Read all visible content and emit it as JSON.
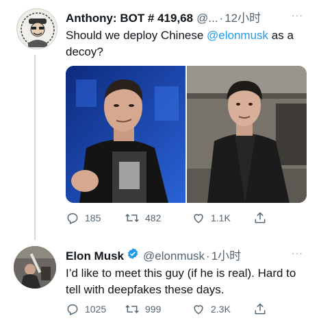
{
  "tweet1": {
    "display_name": "Anthony: BOT # 419,68",
    "handle": "@...",
    "time": "12小时",
    "more_label": "···",
    "text_before": "Should we deploy Chinese ",
    "mention": "@elonmusk",
    "text_after": " as a decoy?",
    "actions": {
      "replies": "185",
      "retweets": "482",
      "likes": "1.1K"
    }
  },
  "tweet2": {
    "display_name": "Elon Musk",
    "handle": "@elonmusk",
    "time": "1小时",
    "more_label": "···",
    "text": "I’d like to meet this guy (if he is real). Hard to tell with deepfakes these days.",
    "actions": {
      "replies": "1025",
      "retweets": "999",
      "likes": "2.3K"
    }
  },
  "colors": {
    "accent": "#1d9bf0",
    "muted": "#536471",
    "verified": "#1d9bf0",
    "photo_left_bg": "#1a3f9c",
    "photo_right_bg": "#6f6a63"
  },
  "icons": [
    "reply-icon",
    "retweet-icon",
    "like-icon",
    "share-icon",
    "verified-badge-icon",
    "more-icon"
  ]
}
